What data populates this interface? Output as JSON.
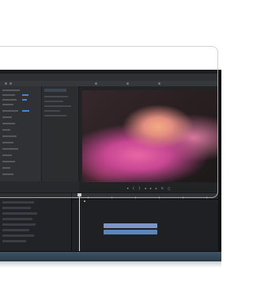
{
  "app": {
    "menu_tabs": [
      "",
      "",
      "",
      ""
    ],
    "active_tab_index": 0
  },
  "monitor": {
    "controls": [
      {
        "icon": "marker-icon",
        "glyph": "▾"
      },
      {
        "icon": "in-point-icon",
        "glyph": "{"
      },
      {
        "icon": "out-point-icon",
        "glyph": "}"
      },
      {
        "icon": "step-back-icon",
        "glyph": "◂"
      },
      {
        "icon": "play-icon",
        "glyph": "▸"
      },
      {
        "icon": "step-forward-icon",
        "glyph": "▸"
      },
      {
        "icon": "loop-icon",
        "glyph": "↻"
      },
      {
        "icon": "export-frame-icon",
        "glyph": "◻"
      }
    ]
  },
  "colors": {
    "accent": "#3b7bd6",
    "video_clip": "#7b95c9",
    "audio_clip": "#5d86b8",
    "marker": "#6fb24a",
    "laptop_base": "#3e5466"
  }
}
